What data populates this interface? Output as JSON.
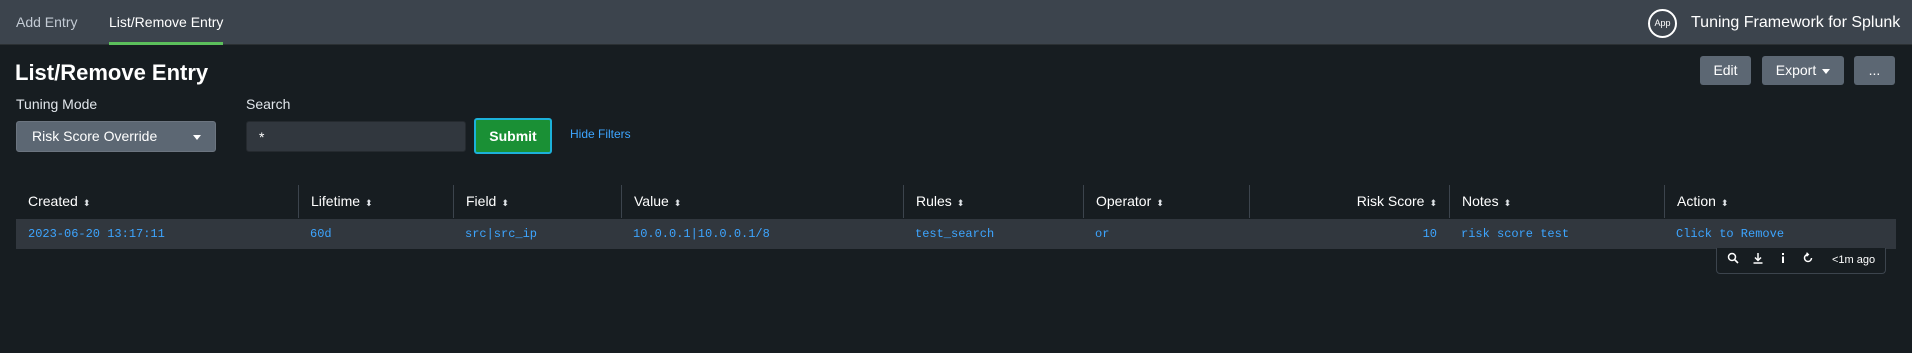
{
  "nav": {
    "tabs": [
      {
        "label": "Add Entry",
        "active": false
      },
      {
        "label": "List/Remove Entry",
        "active": true
      }
    ],
    "app_badge": "App",
    "app_title": "Tuning Framework for Splunk"
  },
  "page": {
    "title": "List/Remove Entry",
    "buttons": {
      "edit": "Edit",
      "export": "Export",
      "more": "..."
    }
  },
  "filters": {
    "tuning_mode": {
      "label": "Tuning Mode",
      "value": "Risk Score Override"
    },
    "search": {
      "label": "Search",
      "value": "*"
    },
    "submit_label": "Submit",
    "hide_filters_label": "Hide Filters"
  },
  "table": {
    "columns": [
      "Created",
      "Lifetime",
      "Field",
      "Value",
      "Rules",
      "Operator",
      "Risk Score",
      "Notes",
      "Action"
    ],
    "sort_glyph": "⬍",
    "rows": [
      {
        "created": "2023-06-20 13:17:11",
        "lifetime": "60d",
        "field": "src|src_ip",
        "value": "10.0.0.1|10.0.0.1/8",
        "rules": "test_search",
        "operator": "or",
        "risk_score": "10",
        "notes": "risk score test",
        "action": "Click to Remove"
      }
    ]
  },
  "panel_footer": {
    "icons": [
      "search-icon",
      "download-icon",
      "info-icon",
      "refresh-icon"
    ],
    "last_refresh": "<1m ago"
  },
  "colors": {
    "accent_green": "#5cc05c",
    "submit_green": "#1a9035",
    "link_blue": "#3da5ff",
    "background": "#171d21"
  }
}
